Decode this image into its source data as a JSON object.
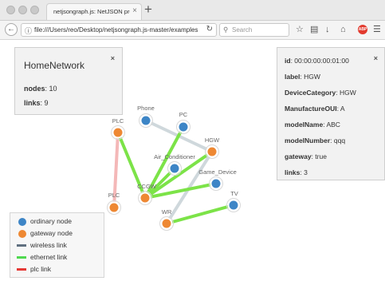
{
  "browser": {
    "tab_title": "netjsongraph.js: NetJSON proper",
    "url": "file:///Users/reo/Desktop/netjsongraph.js-master/examples/",
    "search_placeholder": "Search",
    "new_tab": "+",
    "tab_close": "×",
    "abp_label": "ABP"
  },
  "overview": {
    "title": "HomeNetwork",
    "close": "×",
    "nodes_label": "nodes",
    "nodes_value": ": 10",
    "links_label": "links",
    "links_value": ": 9"
  },
  "details": {
    "close": "×",
    "rows": [
      {
        "key": "id",
        "value": ": 00:00:00:00:01:00"
      },
      {
        "key": "label",
        "value": ": HGW"
      },
      {
        "key": "DeviceCategory",
        "value": ": HGW"
      },
      {
        "key": "ManufactureOUI",
        "value": ": A"
      },
      {
        "key": "modelName",
        "value": ": ABC"
      },
      {
        "key": "modelNumber",
        "value": ": qqq"
      },
      {
        "key": "gateway",
        "value": ": true"
      },
      {
        "key": "links",
        "value": ": 3"
      }
    ]
  },
  "graph": {
    "nodes": [
      {
        "id": "phone",
        "label": "Phone",
        "kind": "ordinary"
      },
      {
        "id": "pc",
        "label": "PC",
        "kind": "ordinary"
      },
      {
        "id": "plc1",
        "label": "PLC",
        "kind": "gateway"
      },
      {
        "id": "hgw",
        "label": "HGW",
        "kind": "gateway"
      },
      {
        "id": "aircon",
        "label": "Air_Conditioner",
        "kind": "ordinary"
      },
      {
        "id": "game",
        "label": "Game_Device",
        "kind": "ordinary"
      },
      {
        "id": "plc2",
        "label": "PLC",
        "kind": "gateway"
      },
      {
        "id": "ccgw",
        "label": "CCGW",
        "kind": "gateway"
      },
      {
        "id": "tv",
        "label": "TV",
        "kind": "ordinary"
      },
      {
        "id": "wr",
        "label": "WR",
        "kind": "gateway"
      }
    ],
    "links": [
      {
        "source": "phone",
        "target": "hgw",
        "type": "wireless"
      },
      {
        "source": "plc1",
        "target": "plc2",
        "type": "plc"
      },
      {
        "source": "plc1",
        "target": "ccgw",
        "type": "ethernet"
      },
      {
        "source": "pc",
        "target": "ccgw",
        "type": "ethernet"
      },
      {
        "source": "hgw",
        "target": "ccgw",
        "type": "ethernet"
      },
      {
        "source": "hgw",
        "target": "wr",
        "type": "wireless"
      },
      {
        "source": "aircon",
        "target": "ccgw",
        "type": "ethernet"
      },
      {
        "source": "game",
        "target": "ccgw",
        "type": "ethernet"
      },
      {
        "source": "wr",
        "target": "tv",
        "type": "ethernet"
      }
    ]
  },
  "legend": [
    {
      "label": "ordinary node",
      "kind": "ordinary-node"
    },
    {
      "label": "gateway node",
      "kind": "gateway-node"
    },
    {
      "label": "wireless link",
      "kind": "wireless"
    },
    {
      "label": "ethernet link",
      "kind": "ethernet"
    },
    {
      "label": "plc link",
      "kind": "plc"
    }
  ],
  "colors": {
    "ordinary_node": "#3d85c6",
    "gateway_node": "#ee8833",
    "wireless_link": "#cfd8dc",
    "ethernet_link": "#7ce348",
    "plc_link": "#f4b8b8",
    "legend_wireless": "#607080",
    "legend_ethernet": "#4fd84f",
    "legend_plc": "#e53935"
  },
  "icons": [
    "back-arrow-icon",
    "info-icon",
    "reload-icon",
    "search-icon",
    "star-icon",
    "reading-list-icon",
    "download-icon",
    "home-icon",
    "adblock-icon",
    "menu-icon",
    "close-icon"
  ]
}
